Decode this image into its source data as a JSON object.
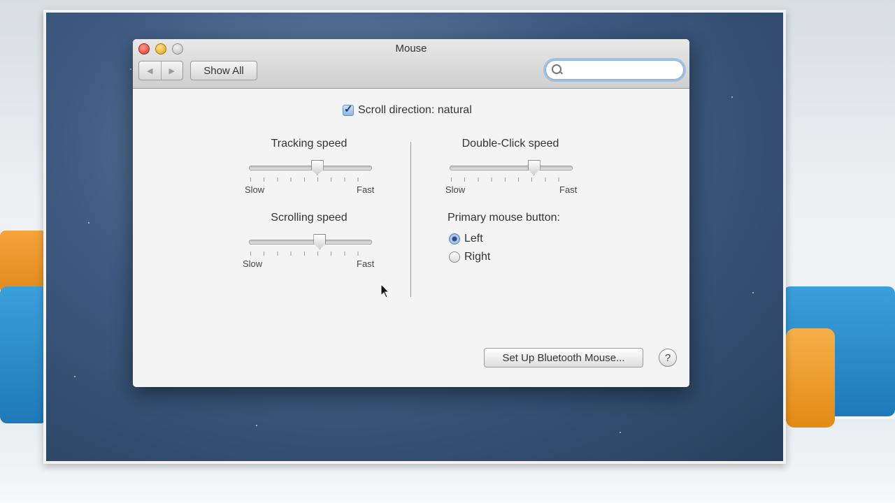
{
  "window": {
    "title": "Mouse",
    "toolbar": {
      "back_icon": "◀",
      "forward_icon": "▶",
      "show_all_label": "Show All"
    },
    "search": {
      "placeholder": ""
    }
  },
  "content": {
    "scroll_direction": {
      "label": "Scroll direction: natural",
      "checked": true
    },
    "tracking_speed": {
      "label": "Tracking speed",
      "min_label": "Slow",
      "max_label": "Fast",
      "value": 0.55
    },
    "scrolling_speed": {
      "label": "Scrolling speed",
      "min_label": "Slow",
      "max_label": "Fast",
      "value": 0.57
    },
    "double_click_speed": {
      "label": "Double-Click speed",
      "min_label": "Slow",
      "max_label": "Fast",
      "value": 0.68
    },
    "primary_button": {
      "label": "Primary mouse button:",
      "options": [
        {
          "label": "Left",
          "selected": true
        },
        {
          "label": "Right",
          "selected": false
        }
      ]
    },
    "bluetooth_button_label": "Set Up Bluetooth Mouse...",
    "help_label": "?"
  },
  "colors": {
    "accent": "#7fb3e6",
    "close": "#d9362b",
    "minimize": "#dfa21a"
  }
}
